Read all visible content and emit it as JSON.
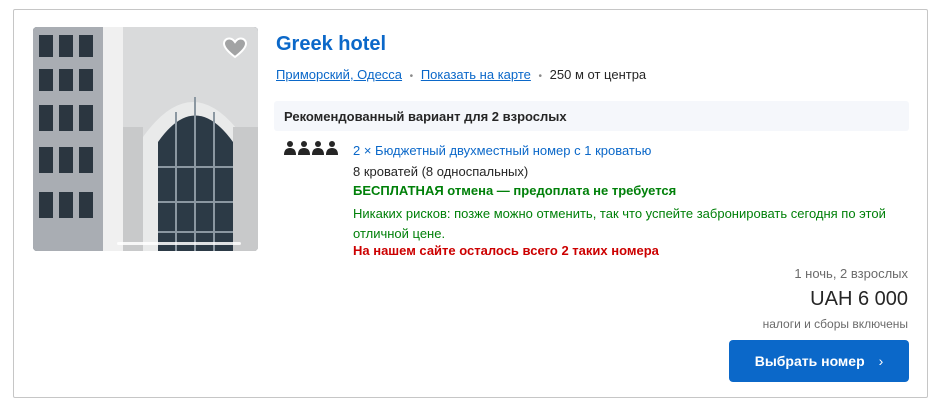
{
  "hotel": {
    "name": "Greek hotel",
    "location_link": "Приморский, Одесса",
    "map_link": "Показать на карте",
    "distance": "250 м от центра",
    "favorite_icon": "heart-outline-icon"
  },
  "recommendation": {
    "header": "Рекомендованный вариант для 2 взрослых",
    "occupancy_icon": "people-icon",
    "room_name": "2 × Бюджетный двухместный номер с 1 кроватью",
    "beds": "8 кроватей (8 односпальных)",
    "free_cancellation": "БЕСПЛАТНАЯ отмена — предоплата не требуется",
    "no_risk": "Никаких рисков: позже можно отменить, так что успейте забронировать сегодня по этой отличной цене.",
    "scarcity": "На нашем сайте осталось всего 2 таких номера"
  },
  "pricing": {
    "nights_guests": "1 ночь, 2 взрослых",
    "price": "UAH 6 000",
    "taxes": "налоги и сборы включены",
    "button_label": "Выбрать номер",
    "button_icon": "chevron-right-icon"
  },
  "colors": {
    "link": "#0b68c9",
    "success": "#008009",
    "alert": "#cc0000",
    "button": "#0b68c9"
  }
}
